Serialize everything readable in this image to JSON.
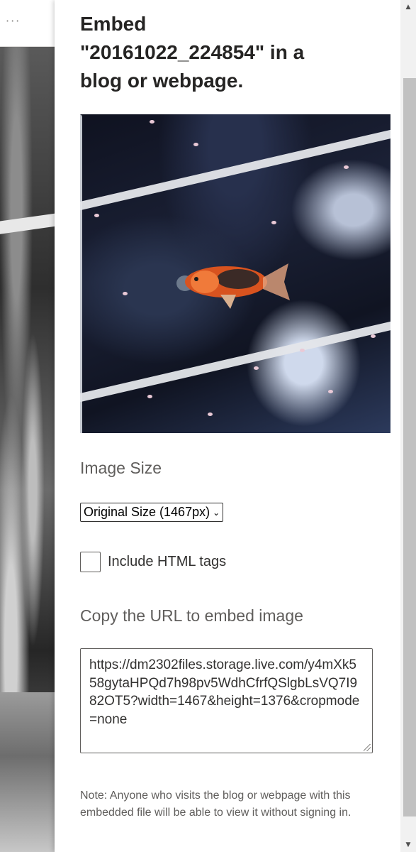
{
  "background": {
    "more_label": "···"
  },
  "panel": {
    "title": "Embed \"20161022_224854\" in a blog or webpage.",
    "image_size_label": "Image Size",
    "size_option": "Original Size (1467px)",
    "include_html_label": "Include HTML tags",
    "include_html_checked": false,
    "copy_url_label": "Copy the URL to embed image",
    "embed_url": "https://dm2302files.storage.live.com/y4mXk558gytaHPQd7h98pv5WdhCfrfQSlgbLsVQ7I982OT5?width=1467&height=1376&cropmode=none",
    "note": "Note: Anyone who visits the blog or webpage with this embedded file will be able to view it without signing in."
  },
  "icons": {
    "more": "more-horizontal-icon",
    "dropdown": "chevron-down-icon",
    "scroll_up": "scroll-up-arrow-icon",
    "scroll_down": "scroll-down-arrow-icon"
  }
}
